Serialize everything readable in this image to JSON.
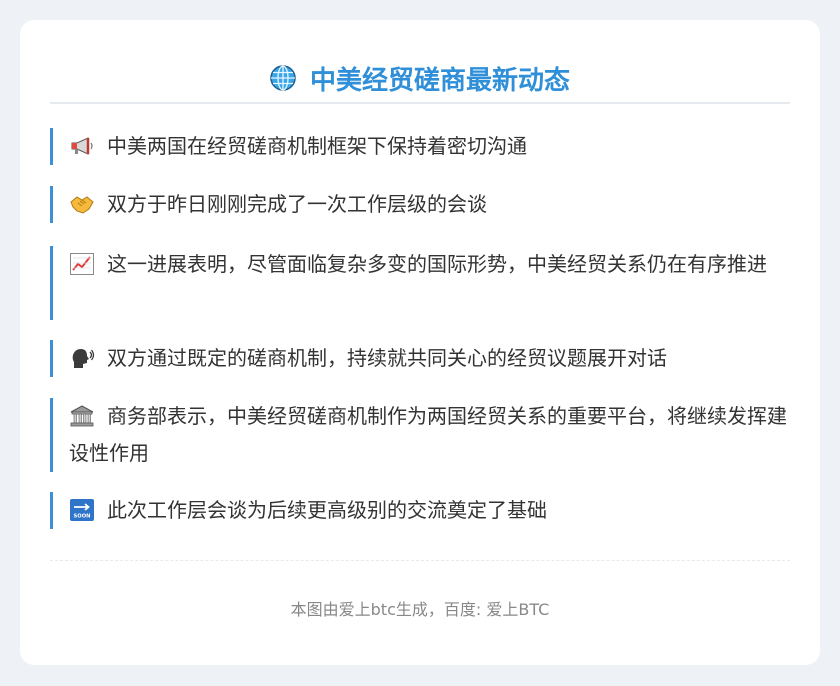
{
  "header": {
    "title": "中美经贸磋商最新动态",
    "icon": "globe-icon"
  },
  "items": [
    {
      "icon": "megaphone-icon",
      "text": "中美两国在经贸磋商机制框架下保持着密切沟通"
    },
    {
      "icon": "handshake-icon",
      "text": "双方于昨日刚刚完成了一次工作层级的会谈"
    },
    {
      "icon": "chart-increasing-icon",
      "text": "这一进展表明，尽管面临复杂多变的国际形势，中美经贸关系仍在有序推进"
    },
    {
      "icon": "speaking-head-icon",
      "text": "双方通过既定的磋商机制，持续就共同关心的经贸议题展开对话"
    },
    {
      "icon": "bank-building-icon",
      "text": "商务部表示，中美经贸磋商机制作为两国经贸关系的重要平台，将继续发挥建设性作用"
    },
    {
      "icon": "soon-arrow-icon",
      "text": "此次工作层会谈为后续更高级别的交流奠定了基础"
    }
  ],
  "footer": {
    "text": "本图由爱上btc生成，百度: 爱上BTC"
  },
  "colors": {
    "accent": "#2f8fd8",
    "border": "#3d8fd6",
    "text": "#333333",
    "muted": "#888888",
    "background": "#eef1f5"
  }
}
